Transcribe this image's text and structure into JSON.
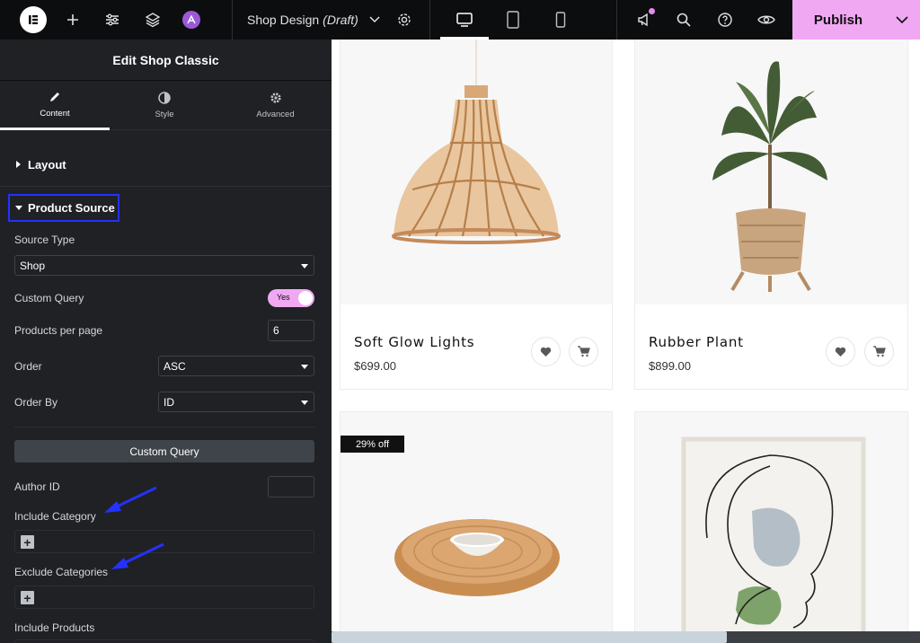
{
  "topbar": {
    "doc_title": "Shop Design",
    "doc_status": "(Draft)",
    "publish_label": "Publish"
  },
  "panel": {
    "header_title": "Edit Shop Classic",
    "tabs": [
      {
        "label": "Content",
        "icon": "pencil-icon"
      },
      {
        "label": "Style",
        "icon": "contrast-icon"
      },
      {
        "label": "Advanced",
        "icon": "gear-icon"
      }
    ],
    "sections": {
      "layout": "Layout",
      "product_source": "Product Source"
    },
    "fields": {
      "source_type_label": "Source Type",
      "source_type_value": "Shop",
      "custom_query_label": "Custom Query",
      "custom_query_toggle": "Yes",
      "products_per_page_label": "Products per page",
      "products_per_page_value": "6",
      "order_label": "Order",
      "order_value": "ASC",
      "order_by_label": "Order By",
      "order_by_value": "ID",
      "custom_query_button": "Custom Query",
      "author_id_label": "Author ID",
      "author_id_value": "",
      "include_category_label": "Include Category",
      "exclude_categories_label": "Exclude Categories",
      "include_products_label": "Include Products",
      "plus": "+"
    },
    "annotation_color": "#2431ff"
  },
  "canvas": {
    "products": [
      {
        "name": "Soft Glow Lights",
        "price": "$699.00"
      },
      {
        "name": "Rubber Plant",
        "price": "$899.00"
      }
    ],
    "sale_badge": "29% off"
  },
  "colors": {
    "accent": "#f0a8f2",
    "panel_bg": "#1f2124",
    "topbar_bg": "#0c0d0e"
  }
}
